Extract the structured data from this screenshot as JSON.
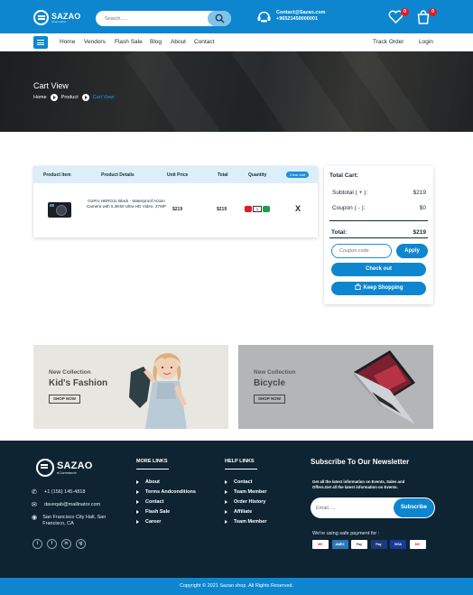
{
  "header": {
    "logo_name": "SAZAO",
    "logo_sub": "eCommerce",
    "search_placeholder": "Search.....",
    "contact_email": "Contact@Sazao.com",
    "contact_phone": "+96521450000001",
    "wishlist_count": "0",
    "cart_count": "0"
  },
  "nav": {
    "items": [
      "Home",
      "Vendors",
      "Flash Sale",
      "Blog",
      "About",
      "Contact"
    ],
    "track_order": "Track Order",
    "login": "Login"
  },
  "hero": {
    "title": "Cart View",
    "breadcrumbs": [
      "Home",
      "Product",
      "Cart View"
    ]
  },
  "cart": {
    "headers": [
      "Product Item",
      "Product Details",
      "Unit Price",
      "Total",
      "Quantity"
    ],
    "clear_label": "Clear cart",
    "items": [
      {
        "details": "GoPro HERO11 Black - Waterproof Action Camera with 5.3K60 Ultra HD Video, 27MP",
        "unit_price": "$219",
        "total": "$219",
        "quantity": "1",
        "remove": "X"
      }
    ]
  },
  "summary": {
    "title": "Total Cart:",
    "subtotal_label": "Subtotal ( + ):",
    "subtotal_value": "$219",
    "coupon_label": "Coupon ( - ):",
    "coupon_value": "$0",
    "total_label": "Total:",
    "total_value": "$219",
    "coupon_placeholder": "Coupon code",
    "apply_label": "Apply",
    "checkout_label": "Check out",
    "keep_label": "Keep Shopping"
  },
  "banners": [
    {
      "tag": "New Collection",
      "title": "Kid's Fashion",
      "button": "SHOP NOW"
    },
    {
      "tag": "New Collection",
      "title": "Bicycle",
      "button": "SHOP NOW"
    }
  ],
  "footer": {
    "logo_name": "SAZAO",
    "logo_sub": "eCommerce",
    "phone": "+1 (156) 145-4818",
    "email": "daveqab@mailinator.com",
    "address": "San Francisco City Hall, San Francisco, CA",
    "socials": [
      "t",
      "f",
      "in",
      "ig"
    ],
    "more_links_title": "MORE LINKS",
    "more_links": [
      "About",
      "Terms Andconditions",
      "Contact",
      "Flash Sale",
      "Career"
    ],
    "help_links_title": "HELP LINKS",
    "help_links": [
      "Contact",
      "Team Member",
      "Order History",
      "Affiliate",
      "Team Member"
    ],
    "newsletter_title": "Subscribe To Our Newsletter",
    "newsletter_text": "Get all the latest information on Events, Sales and Offers.Get all the latest information on Events.",
    "email_placeholder": "Email.....",
    "subscribe_label": "Subscribe",
    "payment_title": "We're using safe payment for :",
    "payments": [
      "MC",
      "AMEX",
      "Pay",
      "Pay",
      "VISA",
      "MC"
    ],
    "copyright": "Copyright © 2021 Sazao shop. All Rights Reserved."
  },
  "colors": {
    "brand": "#0d86cf",
    "footer_bg": "#0e2433",
    "badge": "#e31b23",
    "qty_minus": "#e31b23",
    "qty_plus": "#1f9d4a"
  }
}
